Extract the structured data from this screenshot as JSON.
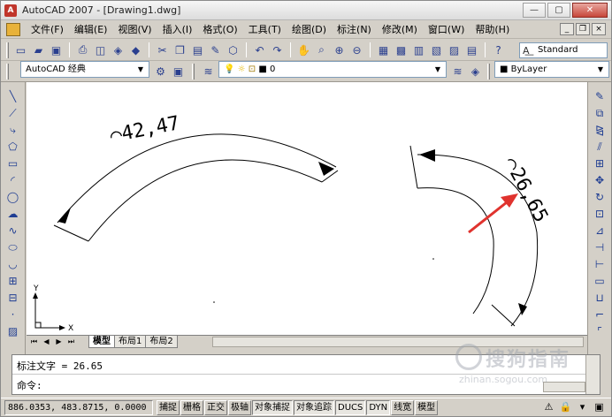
{
  "window": {
    "title": "AutoCAD 2007 - [Drawing1.dwg]",
    "minimize": "—",
    "maximize": "▢",
    "close": "✕"
  },
  "menu": {
    "items": [
      "文件(F)",
      "编辑(E)",
      "视图(V)",
      "插入(I)",
      "格式(O)",
      "工具(T)",
      "绘图(D)",
      "标注(N)",
      "修改(M)",
      "窗口(W)",
      "帮助(H)"
    ],
    "doc_minimize": "_",
    "doc_restore": "❐",
    "doc_close": "×"
  },
  "toolbar": {
    "text_style": "Standard",
    "workspace": "AutoCAD 经典",
    "layer": "0",
    "linetype": "ByLayer"
  },
  "drawing": {
    "dim_left": "⌒42,47",
    "dim_right": "⌒26,65",
    "ucs_y": "Y",
    "ucs_x": "X",
    "arrow_color": "#e0332e"
  },
  "layout_tabs": [
    "模型",
    "布局1",
    "布局2"
  ],
  "command": {
    "history": "标注文字 = 26.65",
    "prompt": "命令:"
  },
  "status": {
    "coords": "886.0353, 483.8715, 0.0000",
    "buttons": [
      "捕捉",
      "栅格",
      "正交",
      "极轴",
      "对象捕捉",
      "对象追踪",
      "DUCS",
      "DYN",
      "线宽",
      "模型"
    ]
  },
  "watermark": {
    "text": "搜狗指南",
    "url": "zhinan.sogou.com"
  }
}
